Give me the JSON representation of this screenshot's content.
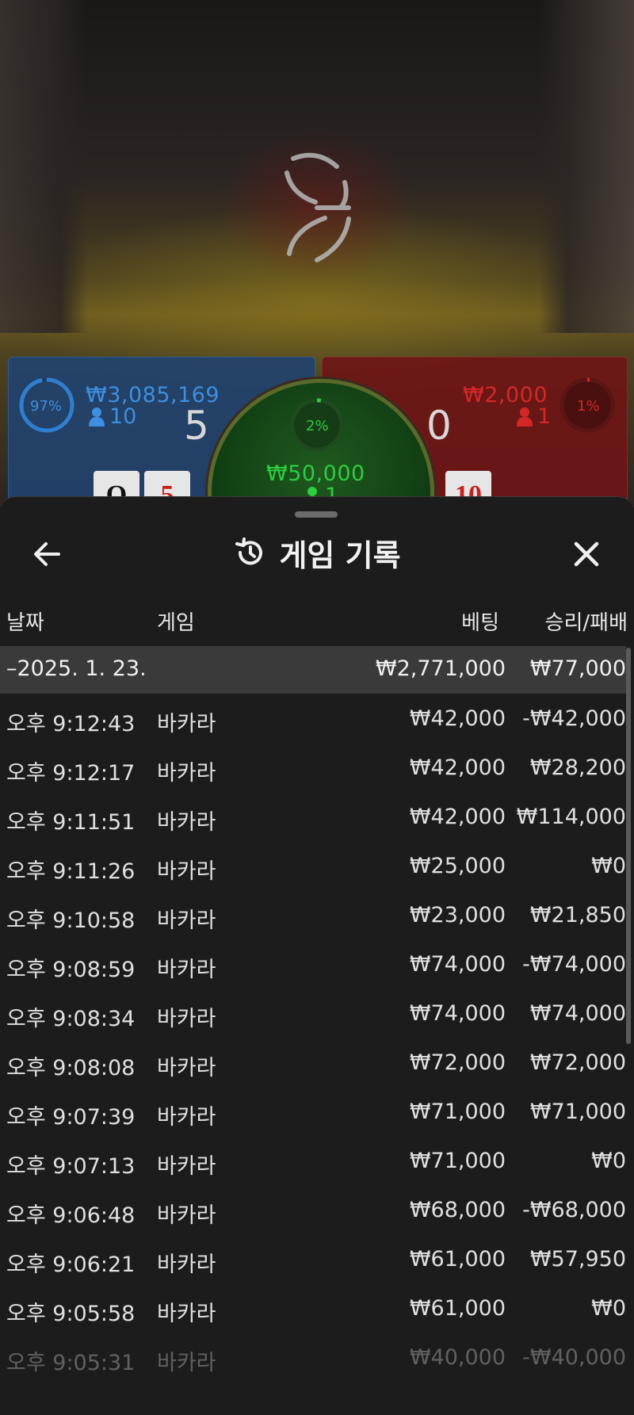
{
  "game": {
    "player": {
      "percent": "97%",
      "amount": "₩3,085,169",
      "count": "10",
      "score": "5",
      "cards": [
        "Q",
        "5"
      ]
    },
    "tie": {
      "percent": "2%",
      "amount": "₩50,000",
      "count": "1"
    },
    "banker": {
      "percent": "1%",
      "amount": "₩2,000",
      "count": "1",
      "score": "0",
      "cards": [
        "10"
      ]
    }
  },
  "header": {
    "title": "게임 기록",
    "icons": {
      "back": "arrow-left-icon",
      "history": "history-icon",
      "close": "close-icon"
    }
  },
  "table": {
    "columns": {
      "date": "날짜",
      "game": "게임",
      "bet": "베팅",
      "winloss": "승리/패배"
    },
    "group": {
      "date": "–2025. 1. 23.",
      "bet": "₩2,771,000",
      "winloss": "₩77,000"
    },
    "rows": [
      {
        "time": "오후 9:12:43",
        "game": "바카라",
        "bet": "₩42,000",
        "winloss": "-₩42,000"
      },
      {
        "time": "오후 9:12:17",
        "game": "바카라",
        "bet": "₩42,000",
        "winloss": "₩28,200"
      },
      {
        "time": "오후 9:11:51",
        "game": "바카라",
        "bet": "₩42,000",
        "winloss": "₩114,000"
      },
      {
        "time": "오후 9:11:26",
        "game": "바카라",
        "bet": "₩25,000",
        "winloss": "₩0"
      },
      {
        "time": "오후 9:10:58",
        "game": "바카라",
        "bet": "₩23,000",
        "winloss": "₩21,850"
      },
      {
        "time": "오후 9:08:59",
        "game": "바카라",
        "bet": "₩74,000",
        "winloss": "-₩74,000"
      },
      {
        "time": "오후 9:08:34",
        "game": "바카라",
        "bet": "₩74,000",
        "winloss": "₩74,000"
      },
      {
        "time": "오후 9:08:08",
        "game": "바카라",
        "bet": "₩72,000",
        "winloss": "₩72,000"
      },
      {
        "time": "오후 9:07:39",
        "game": "바카라",
        "bet": "₩71,000",
        "winloss": "₩71,000"
      },
      {
        "time": "오후 9:07:13",
        "game": "바카라",
        "bet": "₩71,000",
        "winloss": "₩0"
      },
      {
        "time": "오후 9:06:48",
        "game": "바카라",
        "bet": "₩68,000",
        "winloss": "-₩68,000"
      },
      {
        "time": "오후 9:06:21",
        "game": "바카라",
        "bet": "₩61,000",
        "winloss": "₩57,950"
      },
      {
        "time": "오후 9:05:58",
        "game": "바카라",
        "bet": "₩61,000",
        "winloss": "₩0"
      },
      {
        "time": "오후 9:05:31",
        "game": "바카라",
        "bet": "₩40,000",
        "winloss": "-₩40,000"
      }
    ]
  },
  "colors": {
    "player": "#2f7fd0",
    "banker": "#d42828",
    "tie": "#2ecc40",
    "sheet_bg": "#1c1c1c",
    "group_bg": "#3a3a3a"
  }
}
